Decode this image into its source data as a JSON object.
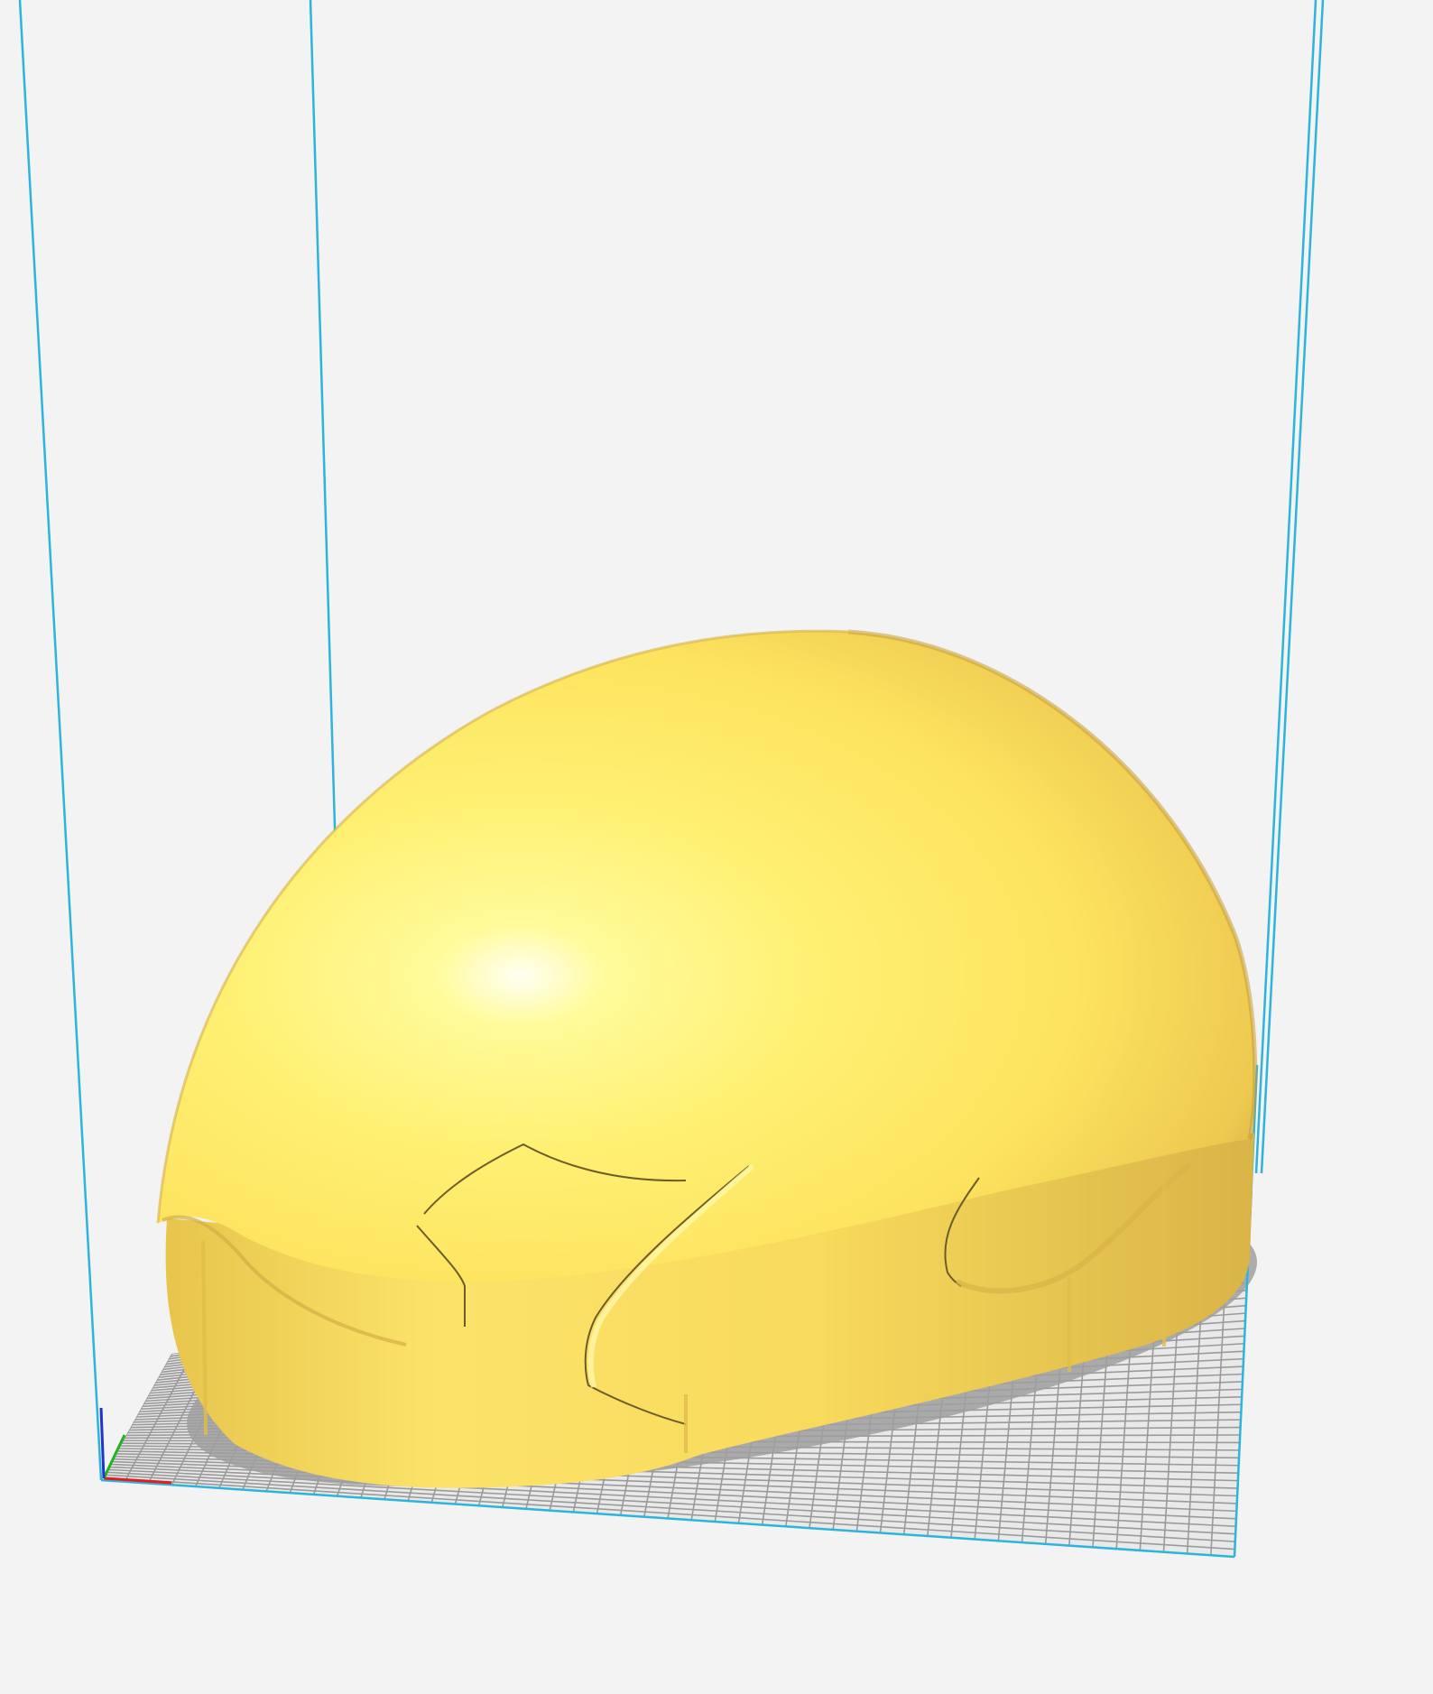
{
  "viewport": {
    "background_color": "#f3f3f3",
    "build_volume_edge_color": "#2eb3dd",
    "build_plate_grid_color": "#9a9a9a",
    "build_plate_fill_color": "#e9e9e9",
    "model_color": "#fde45f",
    "model_shadow_color": "#9f9f9f",
    "axis_colors": {
      "x": "#e21d1d",
      "y": "#1fb51f",
      "z": "#2233cc"
    }
  },
  "model": {
    "shape": "helmet-shell",
    "selected": false
  }
}
